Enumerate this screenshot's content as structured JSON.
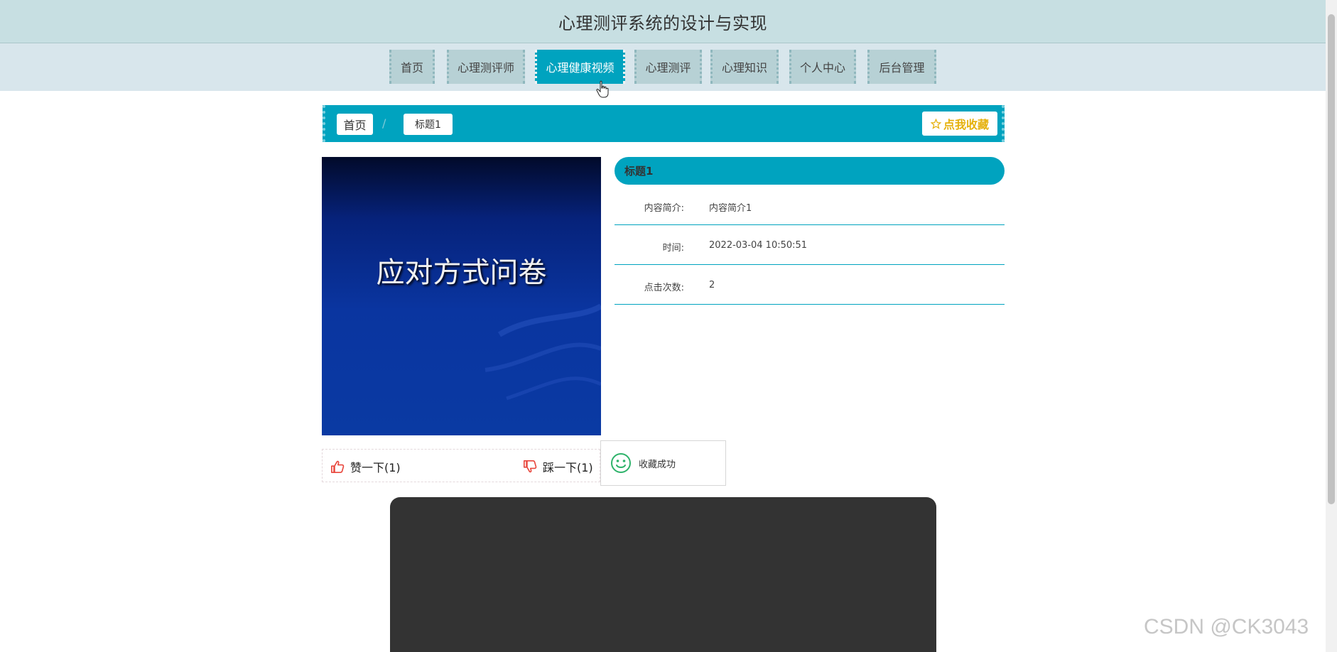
{
  "site": {
    "title": "心理测评系统的设计与实现"
  },
  "nav": {
    "items": [
      {
        "label": "首页"
      },
      {
        "label": "心理测评师"
      },
      {
        "label": "心理健康视频"
      },
      {
        "label": "心理测评"
      },
      {
        "label": "心理知识"
      },
      {
        "label": "个人中心"
      },
      {
        "label": "后台管理"
      }
    ],
    "active_index": 2
  },
  "breadcrumb": {
    "home": "首页",
    "separator": "/",
    "current": "标题1",
    "favorite_label": "点我收藏"
  },
  "cover": {
    "text": "应对方式问卷"
  },
  "detail": {
    "title": "标题1",
    "rows": [
      {
        "label": "内容简介:",
        "value": "内容简介1"
      },
      {
        "label": "时间:",
        "value": "2022-03-04 10:50:51"
      },
      {
        "label": "点击次数:",
        "value": "2"
      }
    ]
  },
  "vote": {
    "like_label": "赞一下(1)",
    "dislike_label": "踩一下(1)"
  },
  "toast": {
    "message": "收藏成功"
  },
  "watermark": "CSDN @CK3043",
  "colors": {
    "accent": "#00a3bf",
    "header_bg": "#c7dfe2",
    "nav_bg": "#d8e6ec",
    "favorite": "#e5b10d",
    "vote_icon": "#e8463c",
    "toast_icon": "#2fb36b"
  }
}
